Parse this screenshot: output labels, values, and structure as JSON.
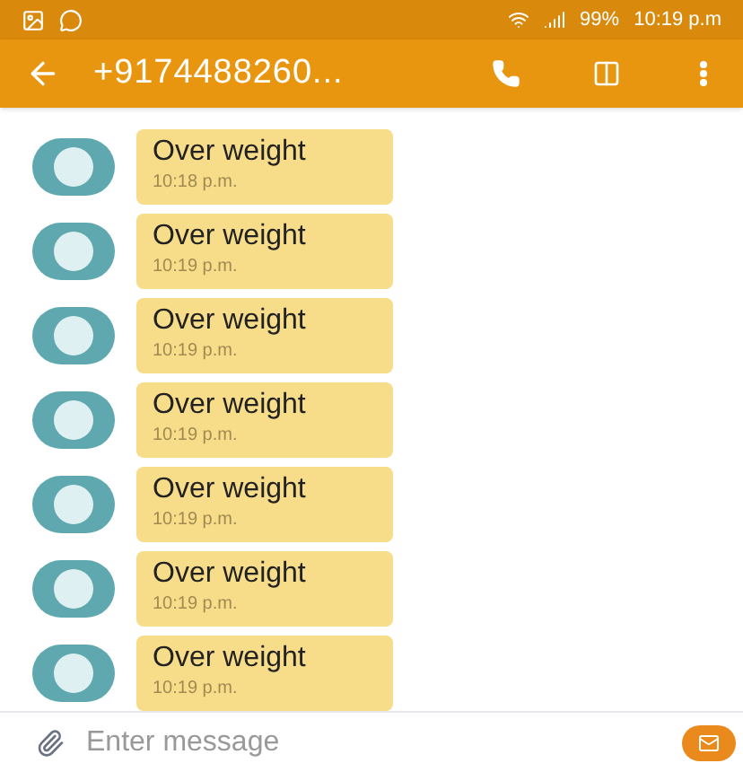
{
  "status_bar": {
    "battery": "99%",
    "time": "10:19 p.m"
  },
  "app_bar": {
    "title": "+9174488260..."
  },
  "messages": [
    {
      "text": "Over weight",
      "time": "10:18 p.m."
    },
    {
      "text": "Over weight",
      "time": "10:19 p.m."
    },
    {
      "text": "Over weight",
      "time": "10:19 p.m."
    },
    {
      "text": "Over weight",
      "time": "10:19 p.m."
    },
    {
      "text": "Over weight",
      "time": "10:19 p.m."
    },
    {
      "text": "Over weight",
      "time": "10:19 p.m."
    },
    {
      "text": "Over weight",
      "time": "10:19 p.m."
    }
  ],
  "composer": {
    "placeholder": "Enter message"
  }
}
